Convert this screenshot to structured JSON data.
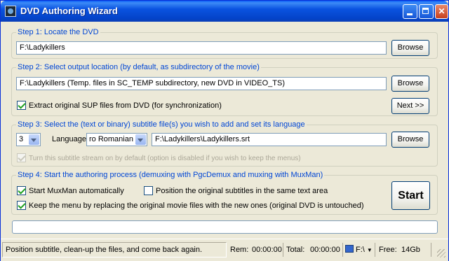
{
  "window": {
    "title": "DVD Authoring Wizard"
  },
  "step1": {
    "legend": "Step 1: Locate the DVD",
    "path": "F:\\Ladykillers",
    "browse_label": "Browse"
  },
  "step2": {
    "legend": "Step 2: Select output location (by default, as subdirectory of the movie)",
    "path": "F:\\Ladykillers (Temp. files in SC_TEMP subdirectory, new DVD in VIDEO_TS)",
    "browse_label": "Browse",
    "extract_sup_label": "Extract original SUP files from DVD (for synchronization)",
    "extract_sup_checked": true,
    "next_label": "Next >>"
  },
  "step3": {
    "legend": "Step 3: Select the (text or binary) subtitle file(s) you wish to add and set its language",
    "stream_number": "3",
    "language_label": "Language:",
    "language_value": "ro Romanian",
    "subtitle_path": "F:\\Ladykillers\\Ladykillers.srt",
    "browse_label": "Browse",
    "default_stream_label": "Turn this subtitle stream on by default (option is disabled if you wish to keep the menus)",
    "default_stream_checked": true
  },
  "step4": {
    "legend": "Step 4: Start the authoring process (demuxing with PgcDemux and muxing with MuxMan)",
    "start_muxman_label": "Start MuxMan automatically",
    "start_muxman_checked": true,
    "position_subs_label": "Position the original subtitles in the same text area",
    "position_subs_checked": false,
    "keep_menu_label": "Keep the menu by replacing the original movie files with the new ones (original DVD is untouched)",
    "keep_menu_checked": true,
    "start_label": "Start"
  },
  "progress": {
    "fraction": 0
  },
  "statusbar": {
    "message": "Position subtitle, clean-up the files, and come back again.",
    "rem_label": "Rem:",
    "rem_value": "00:00:00",
    "total_label": "Total:",
    "total_value": "00:00:00",
    "drive": "F:\\",
    "free_label": "Free:",
    "free_value": "14Gb"
  },
  "colors": {
    "legend": "#0046d5",
    "titlebar": "#0a53e0",
    "progress_fill": "#2ea52e"
  }
}
